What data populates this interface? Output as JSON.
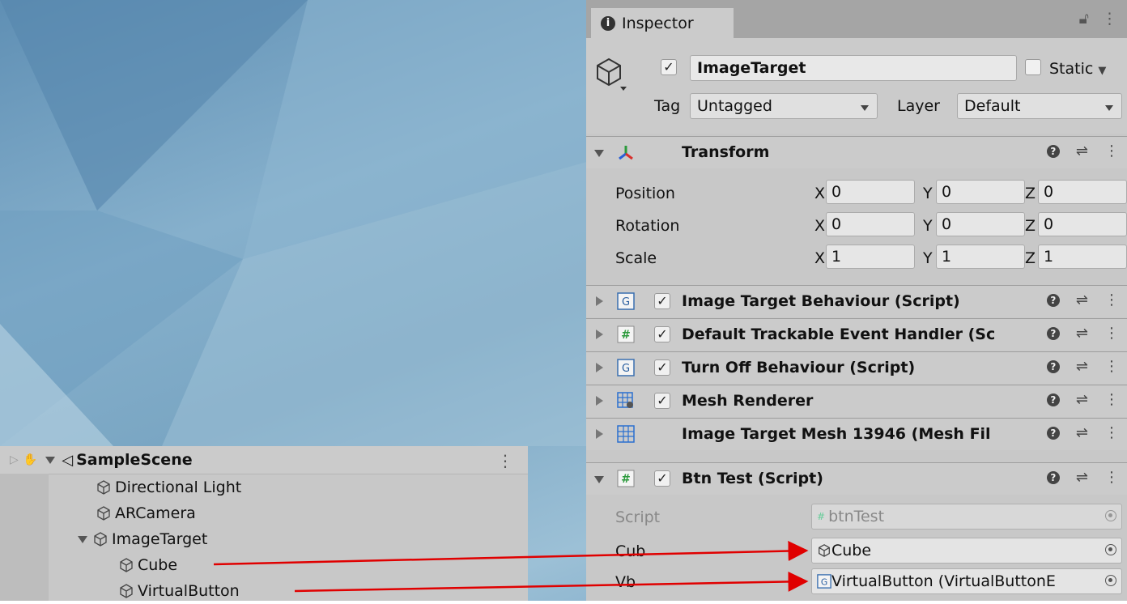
{
  "hierarchy": {
    "scene": "SampleScene",
    "items": [
      {
        "label": "Directional Light"
      },
      {
        "label": "ARCamera"
      },
      {
        "label": "ImageTarget"
      },
      {
        "label": "Cube"
      },
      {
        "label": "VirtualButton"
      }
    ]
  },
  "inspector": {
    "tab_label": "Inspector",
    "object_name": "ImageTarget",
    "static_label": "Static",
    "tag_label": "Tag",
    "tag_value": "Untagged",
    "layer_label": "Layer",
    "layer_value": "Default",
    "transform": {
      "title": "Transform",
      "rows": [
        {
          "label": "Position",
          "x": "0",
          "y": "0",
          "z": "0"
        },
        {
          "label": "Rotation",
          "x": "0",
          "y": "0",
          "z": "0"
        },
        {
          "label": "Scale",
          "x": "1",
          "y": "1",
          "z": "1"
        }
      ],
      "axis_x": "X",
      "axis_y": "Y",
      "axis_z": "Z"
    },
    "components": [
      {
        "title": "Image Target Behaviour (Script)"
      },
      {
        "title": "Default Trackable Event Handler (Sc"
      },
      {
        "title": "Turn Off Behaviour (Script)"
      },
      {
        "title": "Mesh Renderer"
      },
      {
        "title": "Image Target Mesh 13946 (Mesh Fil"
      },
      {
        "title": "Btn Test (Script)"
      }
    ],
    "btn_test": {
      "script_label": "Script",
      "script_value": "btnTest",
      "cub_label": "Cub",
      "cub_value": "Cube",
      "vb_label": "Vb",
      "vb_value": "VirtualButton (VirtualButtonE"
    }
  },
  "colors": {
    "arrow": "#e00000",
    "desktop": "#7aa6c3",
    "panel": "#c8c8c8"
  }
}
